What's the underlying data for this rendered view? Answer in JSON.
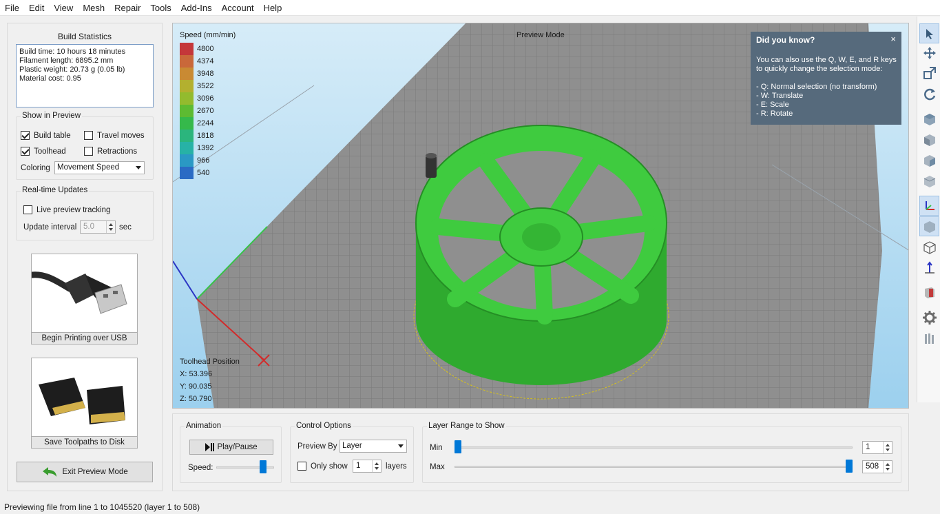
{
  "menu": [
    "File",
    "Edit",
    "View",
    "Mesh",
    "Repair",
    "Tools",
    "Add-Ins",
    "Account",
    "Help"
  ],
  "build_stats": {
    "title": "Build Statistics",
    "lines": [
      "Build time: 10 hours 18 minutes",
      "Filament length: 6895.2 mm",
      "Plastic weight: 20.73 g (0.05 lb)",
      "Material cost: 0.95"
    ]
  },
  "show_in_preview": {
    "title": "Show in Preview",
    "build_table": "Build table",
    "travel_moves": "Travel moves",
    "toolhead": "Toolhead",
    "retractions": "Retractions",
    "coloring_label": "Coloring",
    "coloring_value": "Movement Speed"
  },
  "realtime": {
    "title": "Real-time Updates",
    "live_tracking": "Live preview tracking",
    "interval_label": "Update interval",
    "interval_value": "5.0",
    "interval_unit": "sec"
  },
  "usb_card": {
    "caption": "Begin Printing over USB"
  },
  "sd_card": {
    "caption": "Save Toolpaths to Disk"
  },
  "exit_button": "Exit Preview Mode",
  "viewport": {
    "mode_label": "Preview Mode",
    "legend_title": "Speed (mm/min)",
    "legend": [
      {
        "value": "4800",
        "color": "#c4373a"
      },
      {
        "value": "4374",
        "color": "#c9683a"
      },
      {
        "value": "3948",
        "color": "#c98a33"
      },
      {
        "value": "3522",
        "color": "#b3b02f"
      },
      {
        "value": "3096",
        "color": "#93bb2e"
      },
      {
        "value": "2670",
        "color": "#5dbb32"
      },
      {
        "value": "2244",
        "color": "#35b94b"
      },
      {
        "value": "1818",
        "color": "#2bb57d"
      },
      {
        "value": "1392",
        "color": "#27b2a6"
      },
      {
        "value": "966",
        "color": "#2a99c4"
      },
      {
        "value": "540",
        "color": "#2a6bc4"
      }
    ],
    "toolhead_title": "Toolhead Position",
    "x": "X: 53.396",
    "y": "Y: 90.035",
    "z": "Z: 50.790"
  },
  "tip": {
    "title": "Did you know?",
    "close": "×",
    "body": "You can also use the Q, W, E, and R keys to quickly change the selection mode:\n\n- Q: Normal selection (no transform)\n- W: Translate\n- E: Scale\n- R: Rotate"
  },
  "animation": {
    "title": "Animation",
    "play": "Play/Pause",
    "speed": "Speed:",
    "speed_level": 0.85
  },
  "control": {
    "title": "Control Options",
    "preview_by": "Preview By",
    "preview_value": "Layer",
    "only_show": "Only show",
    "only_value": "1",
    "layers": "layers"
  },
  "layer_range": {
    "title": "Layer Range to Show",
    "min_label": "Min",
    "min_value": "1",
    "max_label": "Max",
    "max_value": "508"
  },
  "status": "Previewing file from line 1 to 1045520 (layer 1 to 508)",
  "toolbar_icons": [
    "select-arrow-icon",
    "translate-icon",
    "scale-icon",
    "rotate-icon",
    "view-cube-1-icon",
    "view-cube-2-icon",
    "view-cube-3-icon",
    "view-cube-4-icon",
    "axes-icon",
    "solid-cube-icon",
    "wireframe-cube-icon",
    "z-axis-icon",
    "section-icon",
    "settings-gear-icon",
    "supports-icon"
  ]
}
